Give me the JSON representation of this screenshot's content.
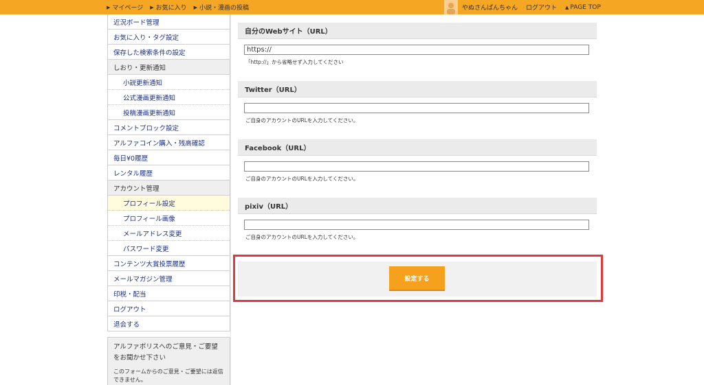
{
  "topbar": {
    "links": [
      {
        "label": "マイページ"
      },
      {
        "label": "お気に入り"
      },
      {
        "label": "小説・漫画の投稿"
      }
    ],
    "username": "やぬさんぱんちゃん",
    "logout": "ログアウト",
    "page_top": "PAGE TOP",
    "bg_color": "#f5a623"
  },
  "sidebar": {
    "items": [
      {
        "label": "近況ボード管理",
        "kind": "item"
      },
      {
        "label": "お気に入り・タグ設定",
        "kind": "item"
      },
      {
        "label": "保存した検索条件の設定",
        "kind": "item"
      },
      {
        "label": "しおり・更新通知",
        "kind": "head"
      },
      {
        "label": "小説更新通知",
        "kind": "sub"
      },
      {
        "label": "公式漫画更新通知",
        "kind": "sub"
      },
      {
        "label": "投稿漫画更新通知",
        "kind": "sub"
      },
      {
        "label": "コメントブロック設定",
        "kind": "item"
      },
      {
        "label": "アルファコイン購入・残高確認",
        "kind": "item"
      },
      {
        "label": "毎日¥0履歴",
        "kind": "item"
      },
      {
        "label": "レンタル履歴",
        "kind": "item"
      },
      {
        "label": "アカウント管理",
        "kind": "head"
      },
      {
        "label": "プロフィール設定",
        "kind": "sub",
        "active": true
      },
      {
        "label": "プロフィール画像",
        "kind": "sub"
      },
      {
        "label": "メールアドレス変更",
        "kind": "sub"
      },
      {
        "label": "パスワード変更",
        "kind": "sub"
      },
      {
        "label": "コンテンツ大賞投票履歴",
        "kind": "item"
      },
      {
        "label": "メールマガジン管理",
        "kind": "item"
      },
      {
        "label": "印税・配当",
        "kind": "item"
      },
      {
        "label": "ログアウト",
        "kind": "item"
      },
      {
        "label": "退会する",
        "kind": "item"
      }
    ],
    "feedback": {
      "title": "アルファポリスへのご意見・ご要望をお聞かせ下さい",
      "text": "このフォームからのご意見・ご要望には返信できません。"
    }
  },
  "form": {
    "website": {
      "label": "自分のWebサイト（URL）",
      "value": "https://",
      "note": "「http://」から省略せず入力してください"
    },
    "twitter": {
      "label": "Twitter（URL）",
      "value": "",
      "note": "ご自身のアカウントのURLを入力してください。"
    },
    "facebook": {
      "label": "Facebook（URL）",
      "value": "",
      "note": "ご自身のアカウントのURLを入力してください。"
    },
    "pixiv": {
      "label": "pixiv（URL）",
      "value": "",
      "note": "ご自身のアカウントのURLを入力してください。"
    },
    "submit_label": "設定する",
    "submit_color": "#f5a11d",
    "highlight_color": "#e3363c"
  }
}
